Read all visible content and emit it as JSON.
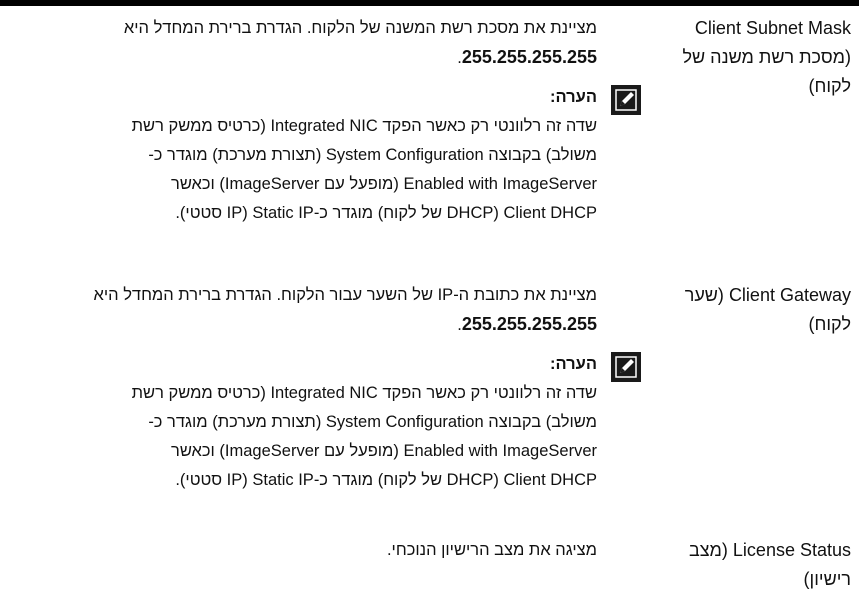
{
  "rows": [
    {
      "term_line1": "Client Subnet Mask",
      "term_line2": "(מסכת רשת משנה של",
      "term_line3": "לקוח)",
      "desc_line1": "מציינת את מסכת רשת המשנה של הלקוח. הגדרת ברירת המחדל היא",
      "desc_value": "255.255.255.255",
      "note_title": "הערה:",
      "note_lines": [
        "שדה זה רלוונטי רק כאשר הפקד Integrated NIC (כרטיס ממשק רשת",
        "משולב) בקבוצה System Configuration (תצורת מערכת) מוגדר כ-",
        "Enabled with ImageServer (מופעל עם ImageServer) וכאשר",
        "Client DHCP (DHCP של לקוח) מוגדר כ-Static IP (IP סטטי)."
      ]
    },
    {
      "term_line1": "Client Gateway (שער",
      "term_line2": "לקוח)",
      "desc_line1": "מציינת את כתובת ה-IP של השער עבור הלקוח. הגדרת ברירת המחדל היא",
      "desc_value": "255.255.255.255",
      "note_title": "הערה:",
      "note_lines": [
        "שדה זה רלוונטי רק כאשר הפקד Integrated NIC (כרטיס ממשק רשת",
        "משולב) בקבוצה System Configuration (תצורת מערכת) מוגדר כ-",
        "Enabled with ImageServer (מופעל עם ImageServer) וכאשר",
        "Client DHCP (DHCP של לקוח) מוגדר כ-Static IP (IP סטטי)."
      ]
    },
    {
      "term_line1": "License Status (מצב",
      "term_line2": "רישיון)",
      "desc_line1": "מציגה את מצב הרישיון הנוכחי."
    }
  ]
}
